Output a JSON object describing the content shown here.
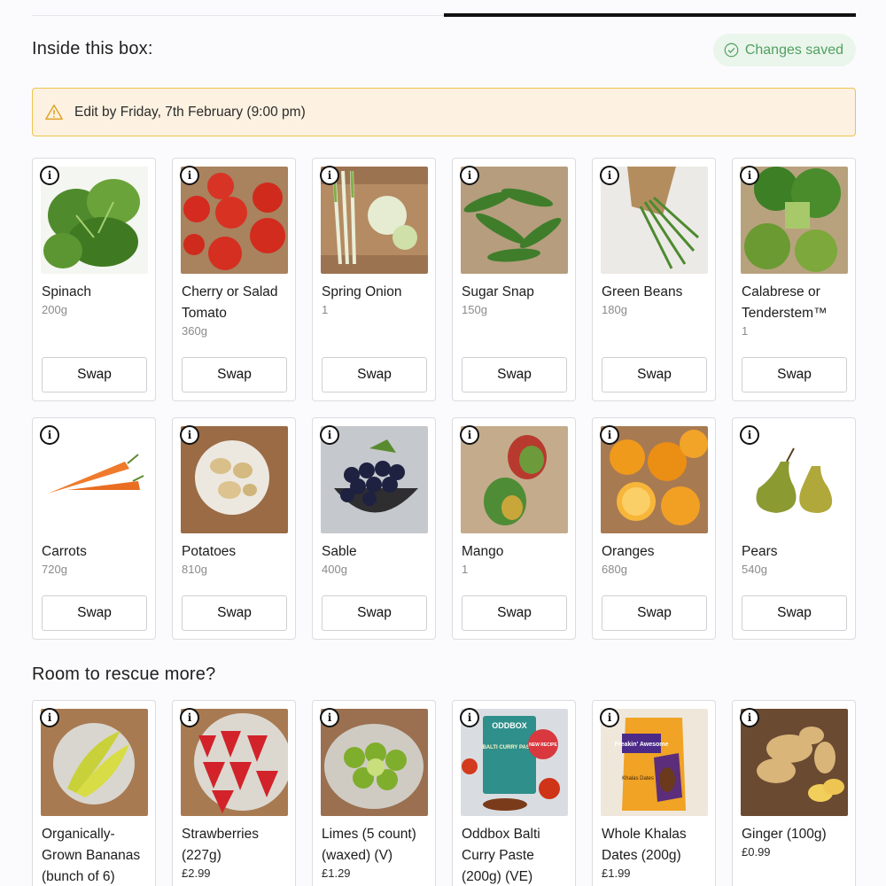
{
  "header": {
    "box_title": "Inside this box:",
    "saved_label": "Changes saved",
    "progress_fraction": 0.5
  },
  "notice": {
    "text": "Edit by Friday, 7th February (9:00 pm)"
  },
  "box_items": [
    {
      "name": "Spinach",
      "qty": "200g",
      "swap": "Swap",
      "icon": "spinach-image"
    },
    {
      "name": "Cherry or Salad Tomato",
      "qty": "360g",
      "swap": "Swap",
      "icon": "tomato-image"
    },
    {
      "name": "Spring Onion",
      "qty": "1",
      "swap": "Swap",
      "icon": "spring-onion-image"
    },
    {
      "name": "Sugar Snap",
      "qty": "150g",
      "swap": "Swap",
      "icon": "sugar-snap-image"
    },
    {
      "name": "Green Beans",
      "qty": "180g",
      "swap": "Swap",
      "icon": "green-beans-image"
    },
    {
      "name": "Calabrese or Tenderstem™",
      "qty": "1",
      "swap": "Swap",
      "icon": "broccoli-image"
    },
    {
      "name": "Carrots",
      "qty": "720g",
      "swap": "Swap",
      "icon": "carrot-image"
    },
    {
      "name": "Potatoes",
      "qty": "810g",
      "swap": "Swap",
      "icon": "potato-image"
    },
    {
      "name": "Sable",
      "qty": "400g",
      "swap": "Swap",
      "icon": "grapes-image"
    },
    {
      "name": "Mango",
      "qty": "1",
      "swap": "Swap",
      "icon": "mango-image"
    },
    {
      "name": "Oranges",
      "qty": "680g",
      "swap": "Swap",
      "icon": "orange-image"
    },
    {
      "name": "Pears",
      "qty": "540g",
      "swap": "Swap",
      "icon": "pear-image"
    }
  ],
  "rescue": {
    "title": "Room to rescue more?",
    "items": [
      {
        "name": "Organically-Grown Bananas (bunch of 6)",
        "price": "",
        "icon": "banana-image"
      },
      {
        "name": "Strawberries (227g)",
        "price": "£2.99",
        "icon": "strawberry-image"
      },
      {
        "name": "Limes (5 count) (waxed) (V)",
        "price": "£1.29",
        "icon": "lime-image"
      },
      {
        "name": "Oddbox Balti Curry Paste (200g) (VE)",
        "price": "",
        "icon": "curry-paste-image",
        "pack_brand": "ODDBOX",
        "pack_text": "BALTI CURRY PASTE",
        "pack_badge": "NEW RECIPE"
      },
      {
        "name": "Whole Khalas Dates (200g)",
        "price": "£1.99",
        "icon": "dates-image",
        "pack_brand": "Freakin' Awesome",
        "pack_text": "Khalas Dates"
      },
      {
        "name": "Ginger (100g)",
        "price": "£0.99",
        "icon": "ginger-image"
      }
    ]
  },
  "colors": {
    "saved_green": "#4fa15e",
    "notice_border": "#efc24a",
    "notice_bg": "#fdf2e1"
  }
}
